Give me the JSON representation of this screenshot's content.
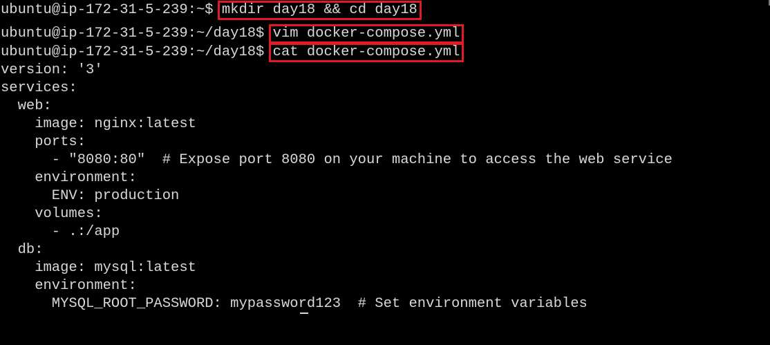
{
  "terminal": {
    "prompt_home": "ubuntu@ip-172-31-5-239:~$ ",
    "prompt_day18": "ubuntu@ip-172-31-5-239:~/day18$ ",
    "commands": [
      "mkdir day18 && cd day18",
      "vim docker-compose.yml",
      "cat docker-compose.yml"
    ],
    "output_lines": [
      "version: '3'",
      "services:",
      "  web:",
      "    image: nginx:latest",
      "    ports:",
      "      - \"8080:80\"  # Expose port 8080 on your machine to access the web service",
      "    environment:",
      "      ENV: production",
      "    volumes:",
      "      - .:/app",
      "  db:",
      "    image: mysql:latest",
      "    environment:",
      "      MYSQL_ROOT_PASSWORD: mypassword123  # Set environment variables"
    ],
    "colors": {
      "background": "#000000",
      "text": "#d8d8d8",
      "highlight_box": "#e01b24"
    }
  }
}
